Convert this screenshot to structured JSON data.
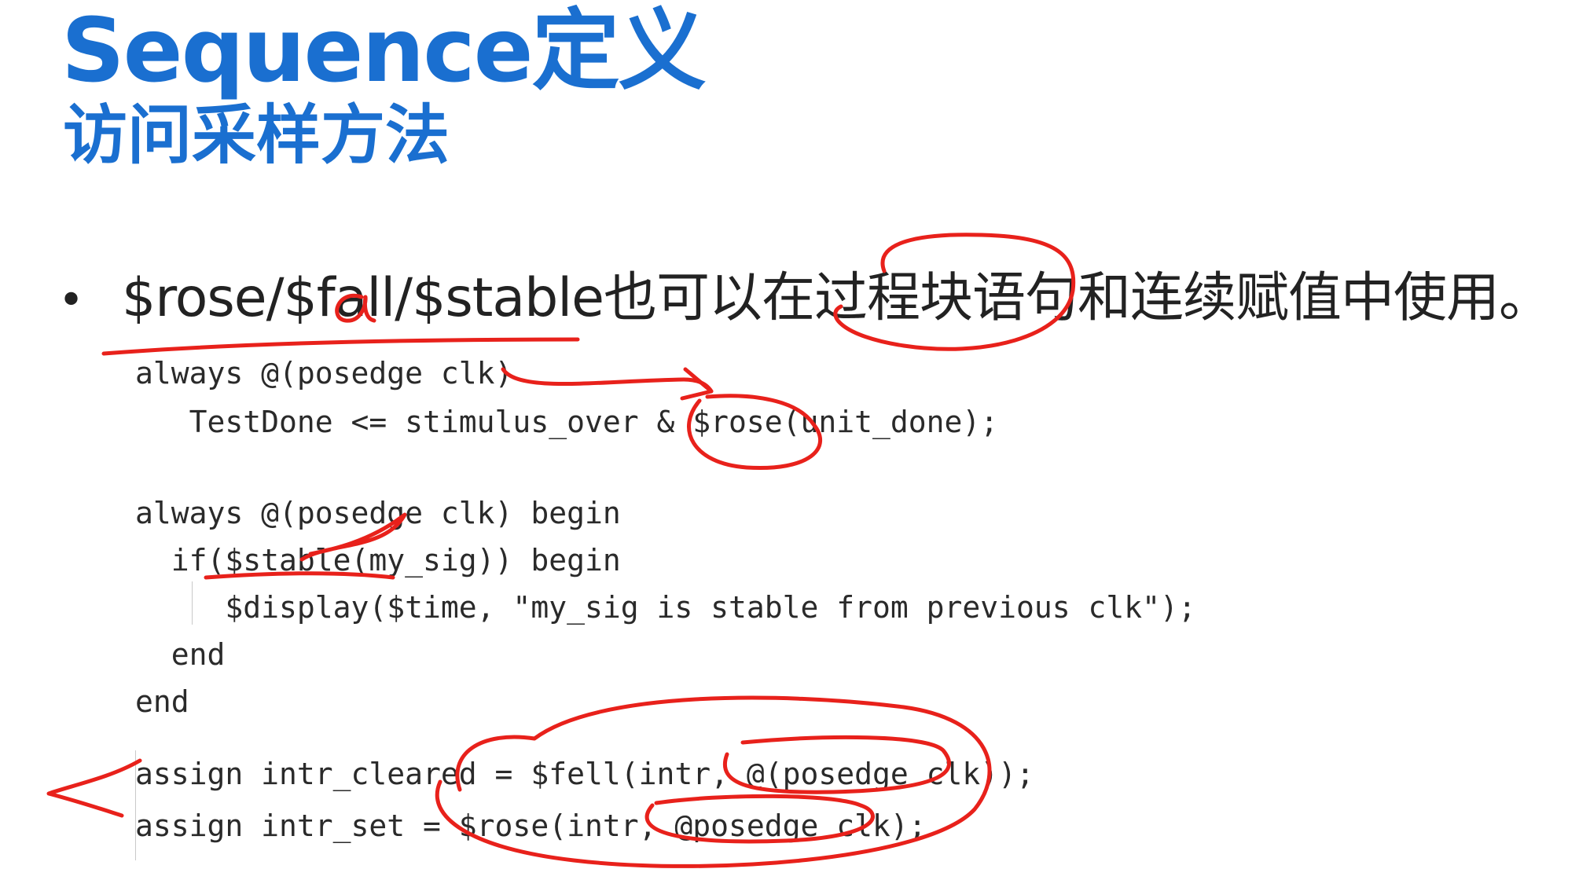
{
  "slide": {
    "title": "Sequence定义",
    "subtitle": "访问采样方法",
    "bullet": "$rose/$fall/$stable也可以在过程块语句和连续赋值中使用。",
    "code_lines": [
      "always @(posedge clk)",
      "   TestDone <= stimulus_over & $rose(unit_done);",
      "",
      "always @(posedge clk) begin",
      "  if($stable(my_sig)) begin",
      "     $display($time, \"my_sig is stable from previous clk\");",
      "  end",
      "end",
      "",
      "assign intr_cleared = $fell(intr, @(posedge clk));",
      "assign intr_set = $rose(intr, @posedge clk);"
    ]
  },
  "annotations": {
    "ink_color": "#e8211b",
    "handwritten_char": "a"
  }
}
